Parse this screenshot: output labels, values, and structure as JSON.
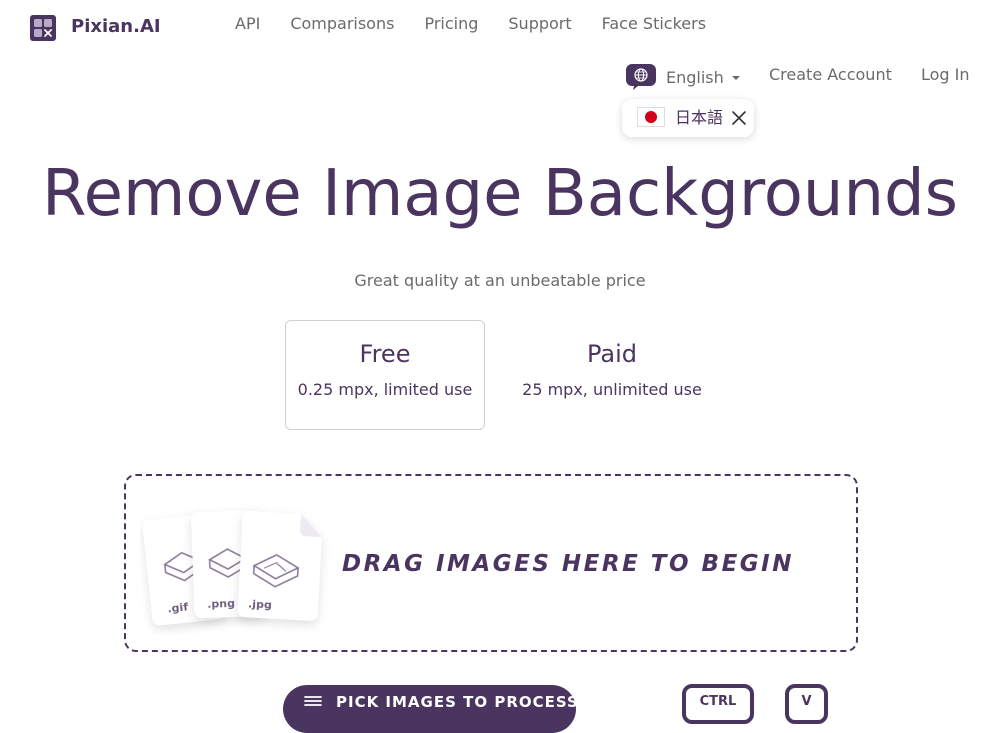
{
  "brand": {
    "name": "Pixian.AI"
  },
  "nav": {
    "items": [
      "API",
      "Comparisons",
      "Pricing",
      "Support",
      "Face Stickers"
    ]
  },
  "account": {
    "language": "English",
    "create_account": "Create Account",
    "log_in": "Log In"
  },
  "language_popup": {
    "label": "日本語",
    "flag_color": "#d0021b"
  },
  "hero": {
    "title": "Remove Image Backgrounds",
    "subtitle": "Great quality at an unbeatable price"
  },
  "plans": [
    {
      "title": "Free",
      "desc": "0.25 mpx, limited use",
      "selected": true
    },
    {
      "title": "Paid",
      "desc": "25 mpx, unlimited use",
      "selected": false
    }
  ],
  "dropzone": {
    "text": "DRAG IMAGES HERE TO BEGIN",
    "file_types": [
      ".gif",
      ".png",
      ".jpg"
    ]
  },
  "bottom": {
    "cta_label": "PICK IMAGES TO PROCESS",
    "button_1": "CTRL",
    "button_2": "V"
  },
  "colors": {
    "brand": "#4a3560",
    "muted": "#6b6b6b",
    "accent_red": "#d0021b"
  }
}
